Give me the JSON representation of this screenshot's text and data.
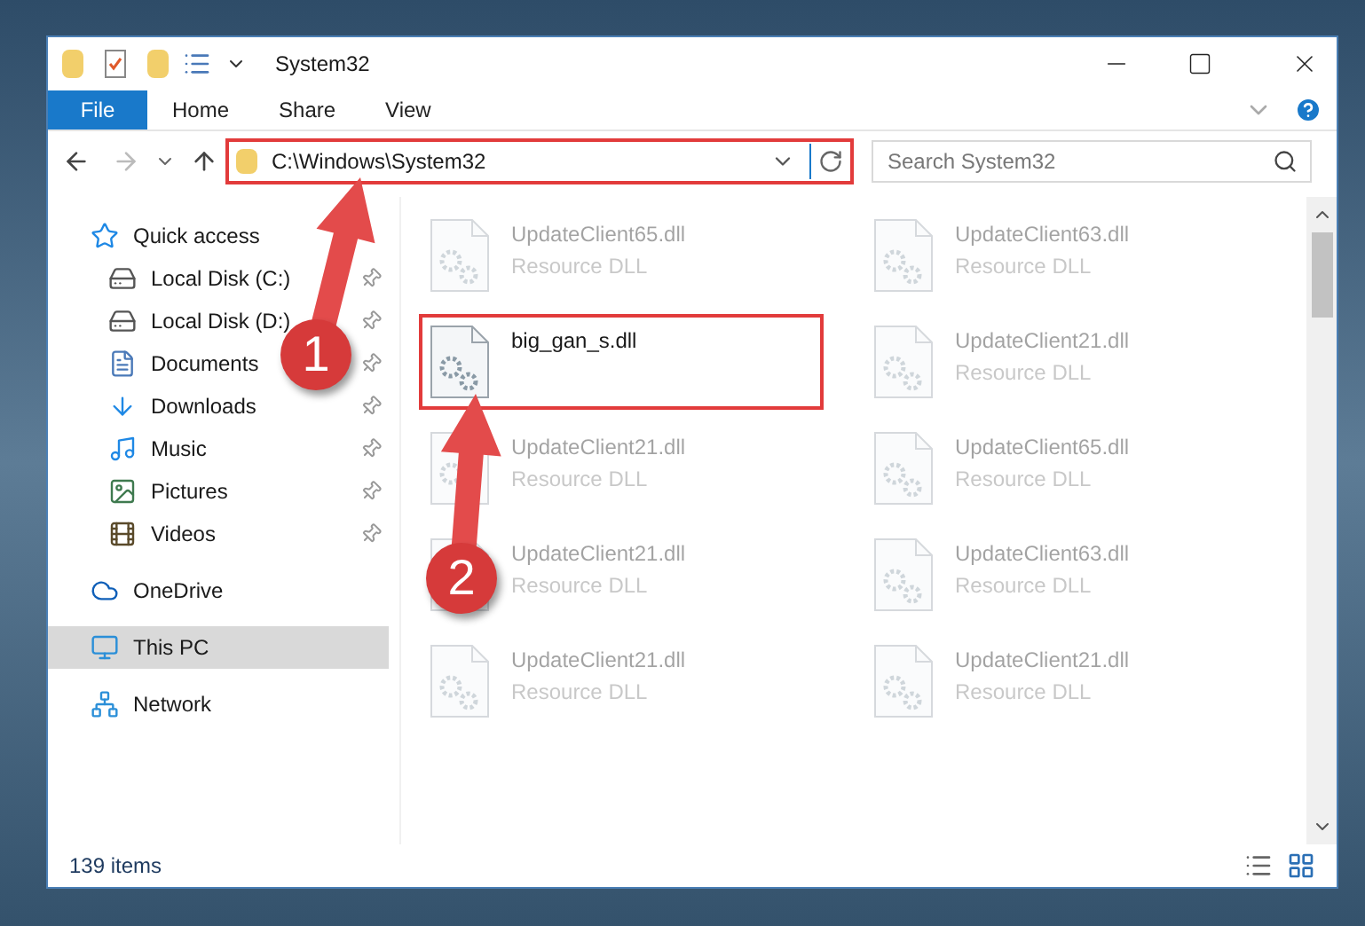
{
  "window": {
    "title": "System32"
  },
  "ribbon": {
    "tabs": [
      {
        "label": "File",
        "kind": "file"
      },
      {
        "label": "Home",
        "kind": "tab"
      },
      {
        "label": "Share",
        "kind": "tab"
      },
      {
        "label": "View",
        "kind": "tab"
      }
    ]
  },
  "address": {
    "value": "C:\\Windows\\System32",
    "highlighted": true
  },
  "search": {
    "placeholder": "Search System32"
  },
  "sidebar": {
    "items": [
      {
        "label": "Quick access",
        "selected": false,
        "children": [
          {
            "label": "Local Disk (C:)",
            "pinned": true
          },
          {
            "label": "Local Disk (D:)",
            "pinned": true
          },
          {
            "label": "Documents",
            "pinned": true
          },
          {
            "label": "Downloads",
            "pinned": true
          },
          {
            "label": "Music",
            "pinned": true
          },
          {
            "label": "Pictures",
            "pinned": true
          },
          {
            "label": "Videos",
            "pinned": true
          }
        ]
      },
      {
        "label": "OneDrive",
        "selected": false
      },
      {
        "label": "This PC",
        "selected": true
      },
      {
        "label": "Network",
        "selected": false
      }
    ]
  },
  "files": [
    {
      "name": "UpdateClient65.dll",
      "type": "Resource DLL",
      "highlighted": false
    },
    {
      "name": "UpdateClient63.dll",
      "type": "Resource DLL",
      "highlighted": false
    },
    {
      "name": "big_gan_s.dll",
      "highlighted": true
    },
    {
      "name": "UpdateClient21.dll",
      "type": "Resource DLL",
      "highlighted": false
    },
    {
      "name": "UpdateClient21.dll",
      "type": "Resource DLL",
      "highlighted": false
    },
    {
      "name": "UpdateClient65.dll",
      "type": "Resource DLL",
      "highlighted": false
    },
    {
      "name": "UpdateClient21.dll",
      "type": "Resource DLL",
      "highlighted": false
    },
    {
      "name": "UpdateClient63.dll",
      "type": "Resource DLL",
      "highlighted": false
    },
    {
      "name": "UpdateClient21.dll",
      "type": "Resource DLL",
      "highlighted": false
    },
    {
      "name": "UpdateClient21.dll",
      "type": "Resource DLL",
      "highlighted": false
    }
  ],
  "status_bar": {
    "count": "139 items"
  },
  "annotations": [
    {
      "label": "1"
    },
    {
      "label": "2"
    }
  ]
}
